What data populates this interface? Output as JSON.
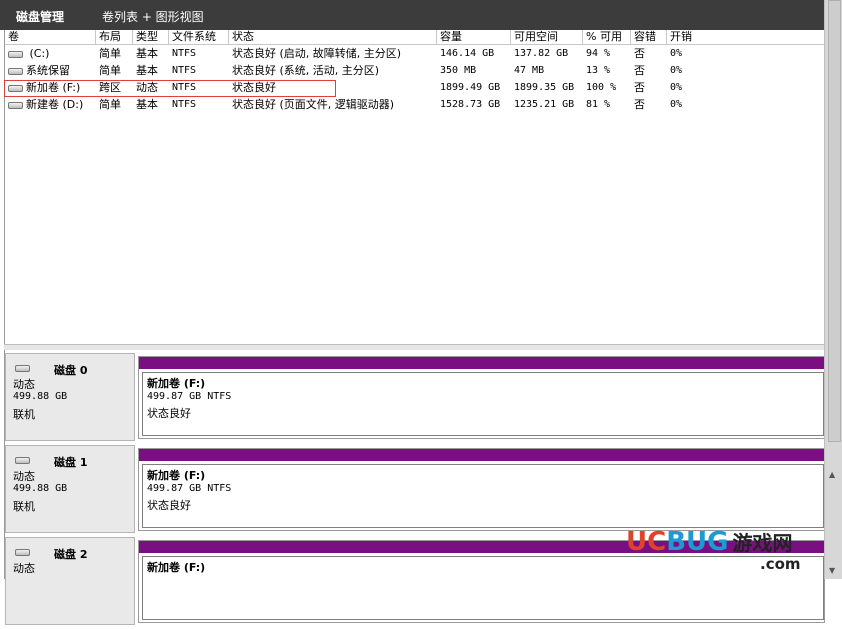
{
  "header": {
    "title": "磁盘管理",
    "view": "卷列表 + 图形视图"
  },
  "table": {
    "columns": [
      "卷",
      "布局",
      "类型",
      "文件系统",
      "状态",
      "容量",
      "可用空间",
      "% 可用",
      "容错",
      "开销"
    ],
    "rows": [
      {
        "vol": " (C:)",
        "layout": "简单",
        "type": "基本",
        "fs": "NTFS",
        "status": "状态良好 (启动, 故障转储, 主分区)",
        "cap": "146.14 GB",
        "free": "137.82 GB",
        "pct": "94 %",
        "ft": "否",
        "ov": "0%"
      },
      {
        "vol": "系统保留",
        "layout": "简单",
        "type": "基本",
        "fs": "NTFS",
        "status": "状态良好 (系统, 活动, 主分区)",
        "cap": "350 MB",
        "free": "47 MB",
        "pct": "13 %",
        "ft": "否",
        "ov": "0%"
      },
      {
        "vol": "新加卷 (F:)",
        "layout": "跨区",
        "type": "动态",
        "fs": "NTFS",
        "status": "状态良好",
        "cap": "1899.49 GB",
        "free": "1899.35 GB",
        "pct": "100 %",
        "ft": "否",
        "ov": "0%"
      },
      {
        "vol": "新建卷 (D:)",
        "layout": "简单",
        "type": "基本",
        "fs": "NTFS",
        "status": "状态良好 (页面文件, 逻辑驱动器)",
        "cap": "1528.73 GB",
        "free": "1235.21 GB",
        "pct": "81 %",
        "ft": "否",
        "ov": "0%"
      }
    ]
  },
  "disks": [
    {
      "name": "磁盘 0",
      "kind": "动态",
      "size": "499.88 GB",
      "state": "联机",
      "vol_name": "新加卷  (F:)",
      "vol_size": "499.87 GB NTFS",
      "vol_status": "状态良好"
    },
    {
      "name": "磁盘 1",
      "kind": "动态",
      "size": "499.88 GB",
      "state": "联机",
      "vol_name": "新加卷  (F:)",
      "vol_size": "499.87 GB NTFS",
      "vol_status": "状态良好"
    },
    {
      "name": "磁盘 2",
      "kind": "动态",
      "size": "",
      "state": "",
      "vol_name": "新加卷  (F:)",
      "vol_size": "",
      "vol_status": ""
    }
  ],
  "watermark": {
    "part1": "UC",
    "part2": "BUG",
    "part3": "游戏网",
    "domain": ".com"
  },
  "colors": {
    "volume_bar": "#7a0f82",
    "selection": "#d8443c",
    "titlebar": "#3c3c3c"
  }
}
